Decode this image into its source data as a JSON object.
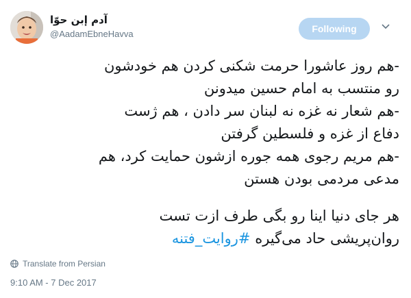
{
  "user": {
    "display_name": "آدم إبن حوّا",
    "handle": "@AadamEbneHavva",
    "avatar_icon": "child-photo-avatar"
  },
  "follow_button": {
    "label": "Following"
  },
  "menu_icon": "chevron-down-icon",
  "tweet": {
    "lines": [
      "-هم روز عاشورا حرمت شکنی کردن هم خودشون",
      "رو منتسب به امام حسین میدونن",
      "-هم شعار نه غزه نه لبنان سر دادن ، هم ژست",
      "دفاع از غزه و فلسطین گرفتن",
      "-هم مریم رجوی همه جوره ازشون حمایت کرد، هم",
      "مدعی مردمی بودن هستن",
      "هر جای دنیا اینا رو بگی طرف ازت تست",
      "روان‌پریشی حاد می‌گیره"
    ],
    "hashtag": "#روایت_فتنه"
  },
  "translate": {
    "label": "Translate from Persian",
    "icon": "globe-icon"
  },
  "timestamp": "9:10 AM - 7 Dec 2017",
  "colors": {
    "accent": "#1b95e0",
    "follow_bg": "#b7d6f2",
    "muted": "#657786",
    "text": "#14171a"
  }
}
